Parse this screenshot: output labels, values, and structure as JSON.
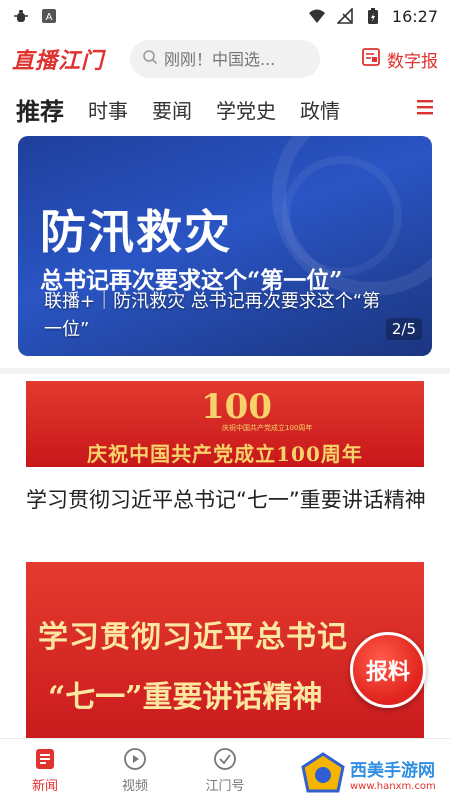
{
  "status_bar": {
    "left_icons": [
      "bug-icon",
      "a-box-icon"
    ],
    "time": "16:27"
  },
  "header": {
    "logo_text": "直播江门",
    "search_placeholder": "刚刚！中国选...",
    "epaper_label": "数字报"
  },
  "tabs": [
    {
      "label": "推荐",
      "active": true
    },
    {
      "label": "时事",
      "active": false
    },
    {
      "label": "要闻",
      "active": false
    },
    {
      "label": "学党史",
      "active": false
    },
    {
      "label": "政情",
      "active": false
    }
  ],
  "hero": {
    "headline_big": "防汛救灾",
    "headline_sub": "总书记再次要求这个“第一位”",
    "caption": "联播+｜防汛救灾 总书记再次要求这个“第一位”",
    "pager": "2/5"
  },
  "anniversary_banner": {
    "logo_number": "100",
    "small_text": "庆祝中国共产党成立100周年",
    "text": "庆祝中国共产党成立100周年"
  },
  "article": {
    "title": "学习贯彻习近平总书记“七一”重要讲话精神",
    "image_line1": "学习贯彻习近平总书记",
    "image_line2": "“七一”重要讲话精神"
  },
  "report_button": {
    "label": "报料"
  },
  "bottom_nav": [
    {
      "label": "新闻",
      "icon": "news-icon",
      "active": true
    },
    {
      "label": "视频",
      "icon": "play-icon",
      "active": false
    },
    {
      "label": "江门号",
      "icon": "check-circle-icon",
      "active": false
    }
  ],
  "watermark": {
    "main": "西美手游网",
    "sub": "www.hanxm.com"
  },
  "colors": {
    "brand_red": "#e0322e",
    "hero_blue": "#2a55c4",
    "gold": "#f6d36a"
  }
}
